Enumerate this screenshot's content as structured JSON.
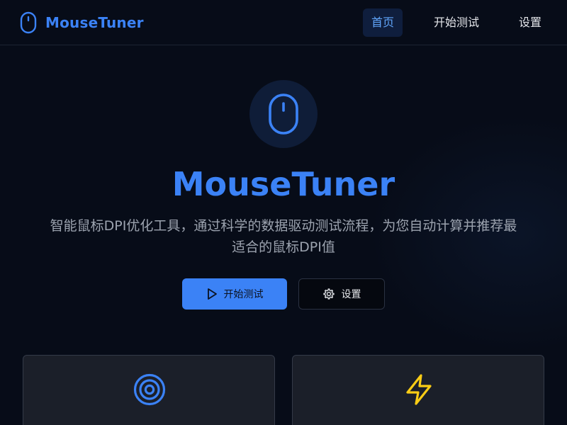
{
  "header": {
    "brand_name": "MouseTuner",
    "brand_icon": "mouse-icon",
    "nav": {
      "home_label": "首页",
      "test_label": "开始测试",
      "settings_label": "设置"
    },
    "active_nav": "home"
  },
  "hero": {
    "icon": "mouse-icon",
    "title": "MouseTuner",
    "description": "智能鼠标DPI优化工具，通过科学的数据驱动测试流程，为您自动计算并推荐最适合的鼠标DPI值",
    "primary_button": {
      "label": "开始测试",
      "icon": "play-icon"
    },
    "secondary_button": {
      "label": "设置",
      "icon": "gear-icon"
    }
  },
  "cards": [
    {
      "icon": "target-icon"
    },
    {
      "icon": "lightning-icon"
    }
  ],
  "colors": {
    "background": "#070c18",
    "accent": "#3b82f6",
    "nav_active_bg": "#0f1e3d",
    "muted_text": "#9ca3af",
    "card_bg": "#1b1f29",
    "lightning": "#facc15"
  }
}
